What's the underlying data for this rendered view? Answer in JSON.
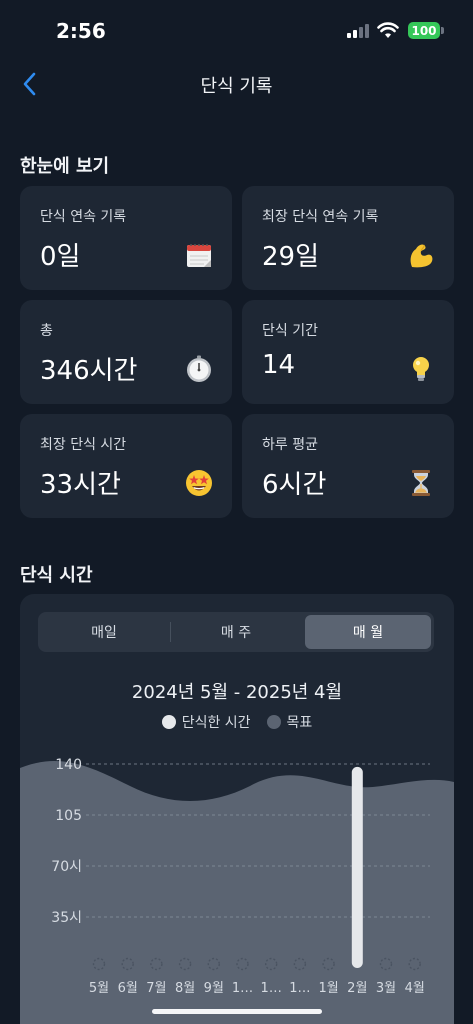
{
  "status_bar": {
    "time": "2:56",
    "battery": "100"
  },
  "nav": {
    "title": "단식 기록"
  },
  "summary": {
    "title": "한눈에 보기",
    "cards": [
      {
        "label": "단식 연속 기록",
        "value": "0일",
        "icon": "calendar-icon"
      },
      {
        "label": "최장 단식 연속 기록",
        "value": "29일",
        "icon": "flexed-biceps-icon"
      },
      {
        "label": "총",
        "value": "346시간",
        "icon": "stopwatch-icon"
      },
      {
        "label": "단식 기간",
        "value": "14",
        "icon": "light-bulb-icon"
      },
      {
        "label": "최장 단식 시간",
        "value": "33시간",
        "icon": "star-struck-face-icon"
      },
      {
        "label": "하루 평균",
        "value": "6시간",
        "icon": "hourglass-icon"
      }
    ]
  },
  "fasting_time": {
    "title": "단식 시간",
    "tabs": [
      {
        "label": "매일",
        "active": false
      },
      {
        "label": "매 주",
        "active": false
      },
      {
        "label": "매 월",
        "active": true
      }
    ],
    "range": "2024년 5월 - 2025년 4월",
    "legend": [
      {
        "label": "단식한 시간",
        "color": "#e6e8eb"
      },
      {
        "label": "목표",
        "color": "#5b6472"
      }
    ]
  },
  "chart_data": {
    "type": "bar",
    "categories": [
      "5월",
      "6월",
      "7월",
      "8월",
      "9월",
      "1…",
      "1…",
      "1…",
      "1월",
      "2월",
      "3월",
      "4월"
    ],
    "series": [
      {
        "name": "단식한 시간",
        "values": [
          0,
          0,
          0,
          0,
          0,
          0,
          0,
          0,
          0,
          138,
          0,
          0
        ]
      }
    ],
    "y_tick_labels": [
      "35시",
      "70시",
      "105",
      "140"
    ],
    "y_ticks": [
      35,
      70,
      105,
      140
    ],
    "ylim": [
      0,
      140
    ],
    "goal_band": "wavy shaded area",
    "colors": {
      "bar": "#e6e8eb",
      "goal_area": "#5b6472",
      "empty_marker": "#4a5361"
    }
  }
}
